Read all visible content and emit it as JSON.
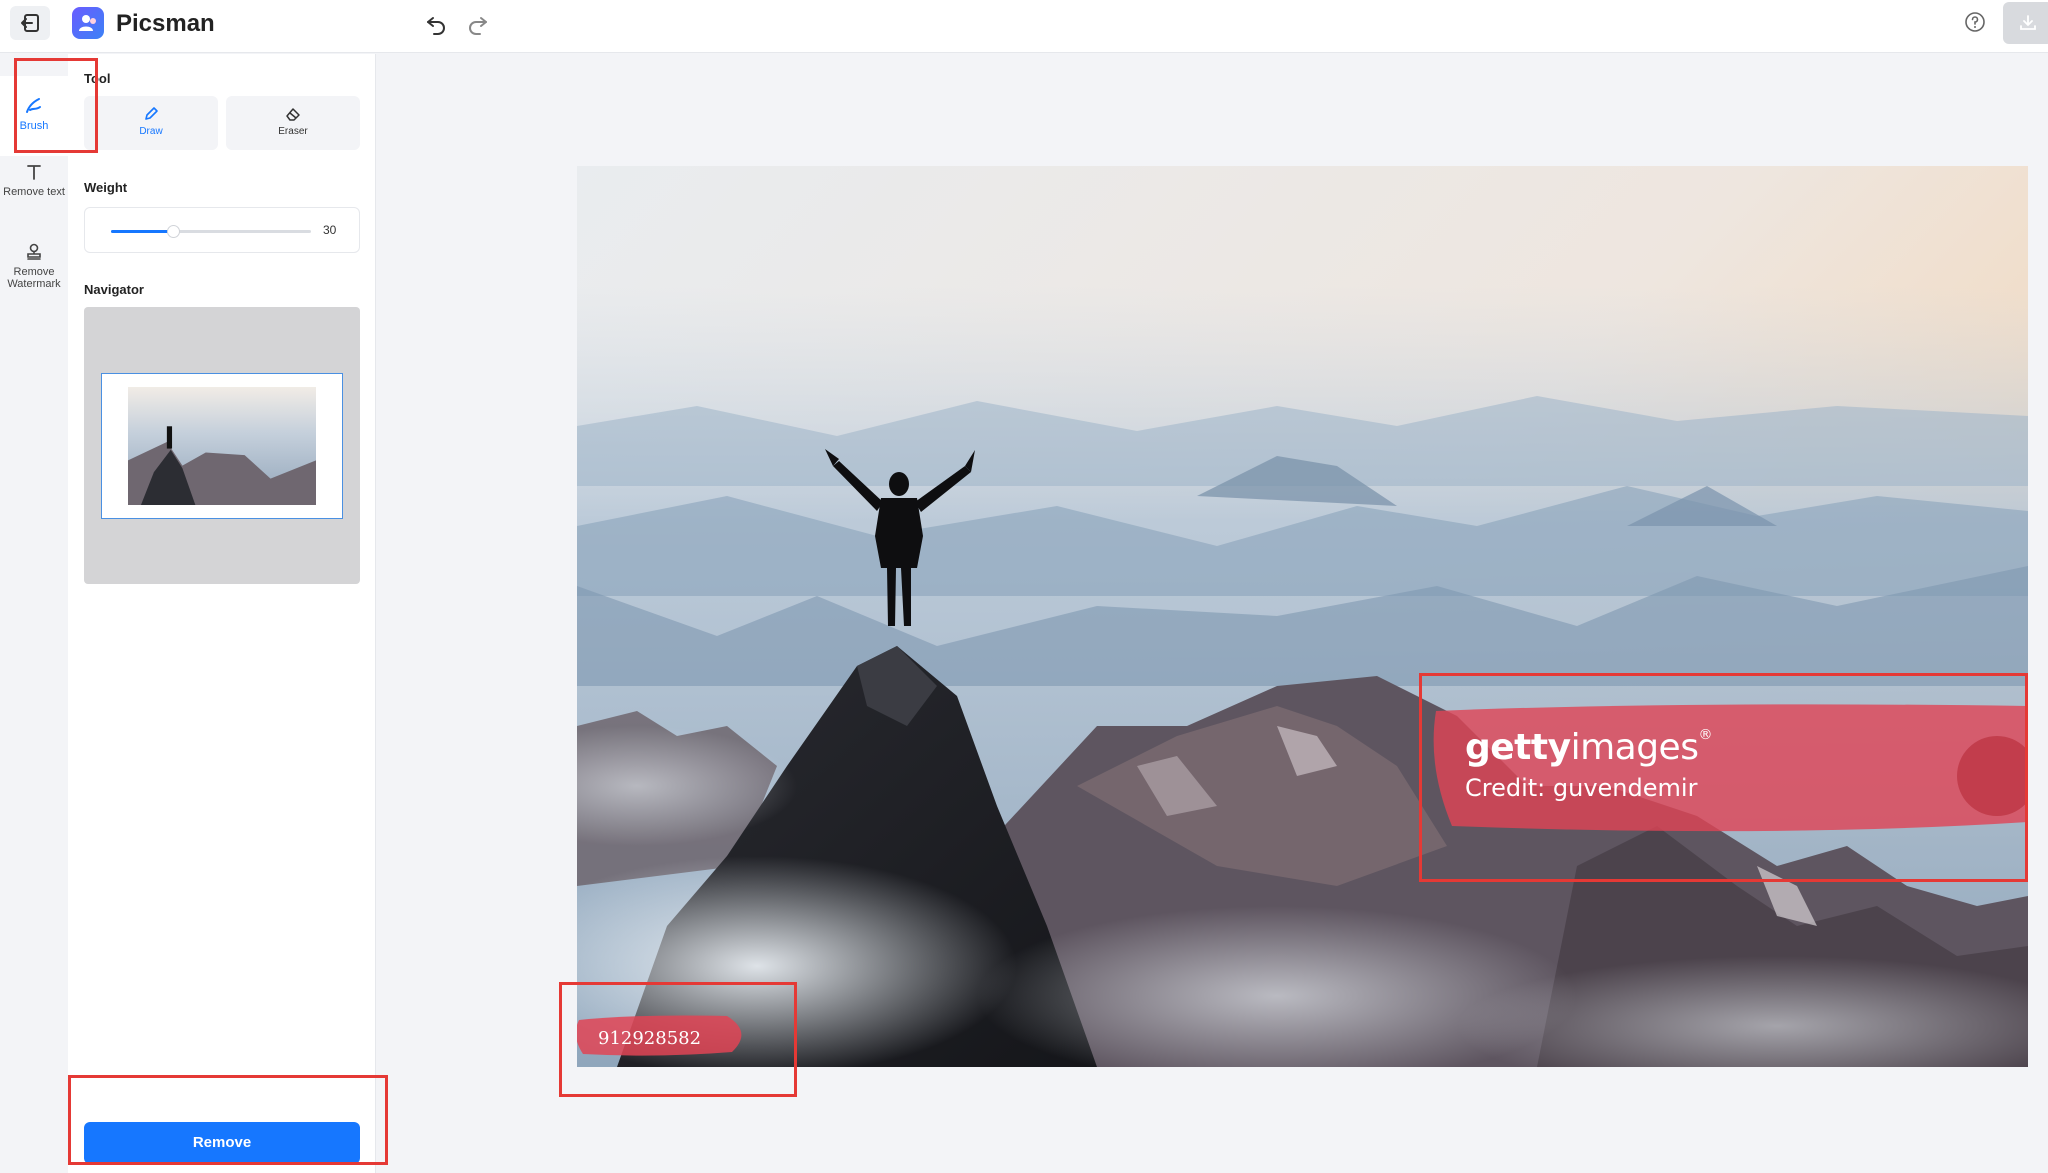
{
  "app": {
    "title": "Picsman"
  },
  "rail": {
    "items": [
      {
        "label": "Brush"
      },
      {
        "label": "Remove text"
      },
      {
        "label": "Remove Watermark"
      }
    ]
  },
  "panel": {
    "tool_label": "Tool",
    "tools": [
      {
        "label": "Draw"
      },
      {
        "label": "Eraser"
      }
    ],
    "weight_label": "Weight",
    "weight_value": "30",
    "navigator_label": "Navigator",
    "remove_label": "Remove"
  },
  "canvas": {
    "watermark_brand_bold": "getty",
    "watermark_brand_light": "images",
    "watermark_brand_mark": "®",
    "watermark_credit": "Credit: guvendemir",
    "watermark_id": "912928582"
  },
  "colors": {
    "accent": "#1677ff",
    "annotation": "#e53935",
    "brush_highlight": "#e04455"
  }
}
